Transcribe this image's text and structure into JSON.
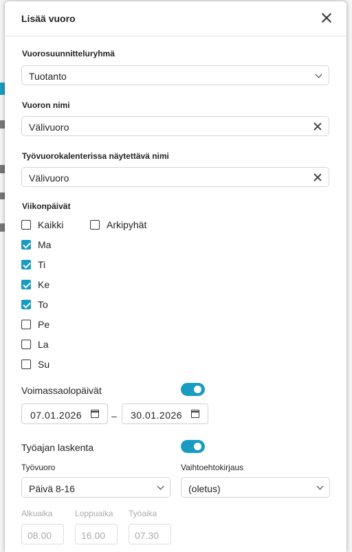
{
  "dialog": {
    "title": "Lisää vuoro"
  },
  "group": {
    "label": "Vuorosuunnitteluryhmä",
    "value": "Tuotanto"
  },
  "shift_name": {
    "label": "Vuoron nimi",
    "value": "Välivuoro"
  },
  "calendar_name": {
    "label": "Työvuorokalenterissa näytettävä nimi",
    "value": "Välivuoro"
  },
  "weekdays": {
    "label": "Viikonpäivät",
    "all": {
      "label": "Kaikki",
      "checked": false
    },
    "holidays": {
      "label": "Arkipyhät",
      "checked": false
    },
    "days": [
      {
        "label": "Ma",
        "checked": true
      },
      {
        "label": "Ti",
        "checked": true
      },
      {
        "label": "Ke",
        "checked": true
      },
      {
        "label": "To",
        "checked": true
      },
      {
        "label": "Pe",
        "checked": false
      },
      {
        "label": "La",
        "checked": false
      },
      {
        "label": "Su",
        "checked": false
      }
    ]
  },
  "validity": {
    "label": "Voimassaolopäivät",
    "enabled": true,
    "start": "07.01.2026",
    "separator": "–",
    "end": "30.01.2026"
  },
  "worktime": {
    "label": "Työajan laskenta",
    "enabled": true,
    "shift_label": "Työvuoro",
    "shift_value": "Päivä 8-16",
    "alt_label": "Vaihtoehtokirjaus",
    "alt_value": "(oletus)",
    "start_label": "Alkuaika",
    "start_value": "08.00",
    "end_label": "Loppuaika",
    "end_value": "16.00",
    "duration_label": "Työaika",
    "duration_value": "07.30"
  },
  "colors": {
    "accent": "#1a9bc2"
  }
}
